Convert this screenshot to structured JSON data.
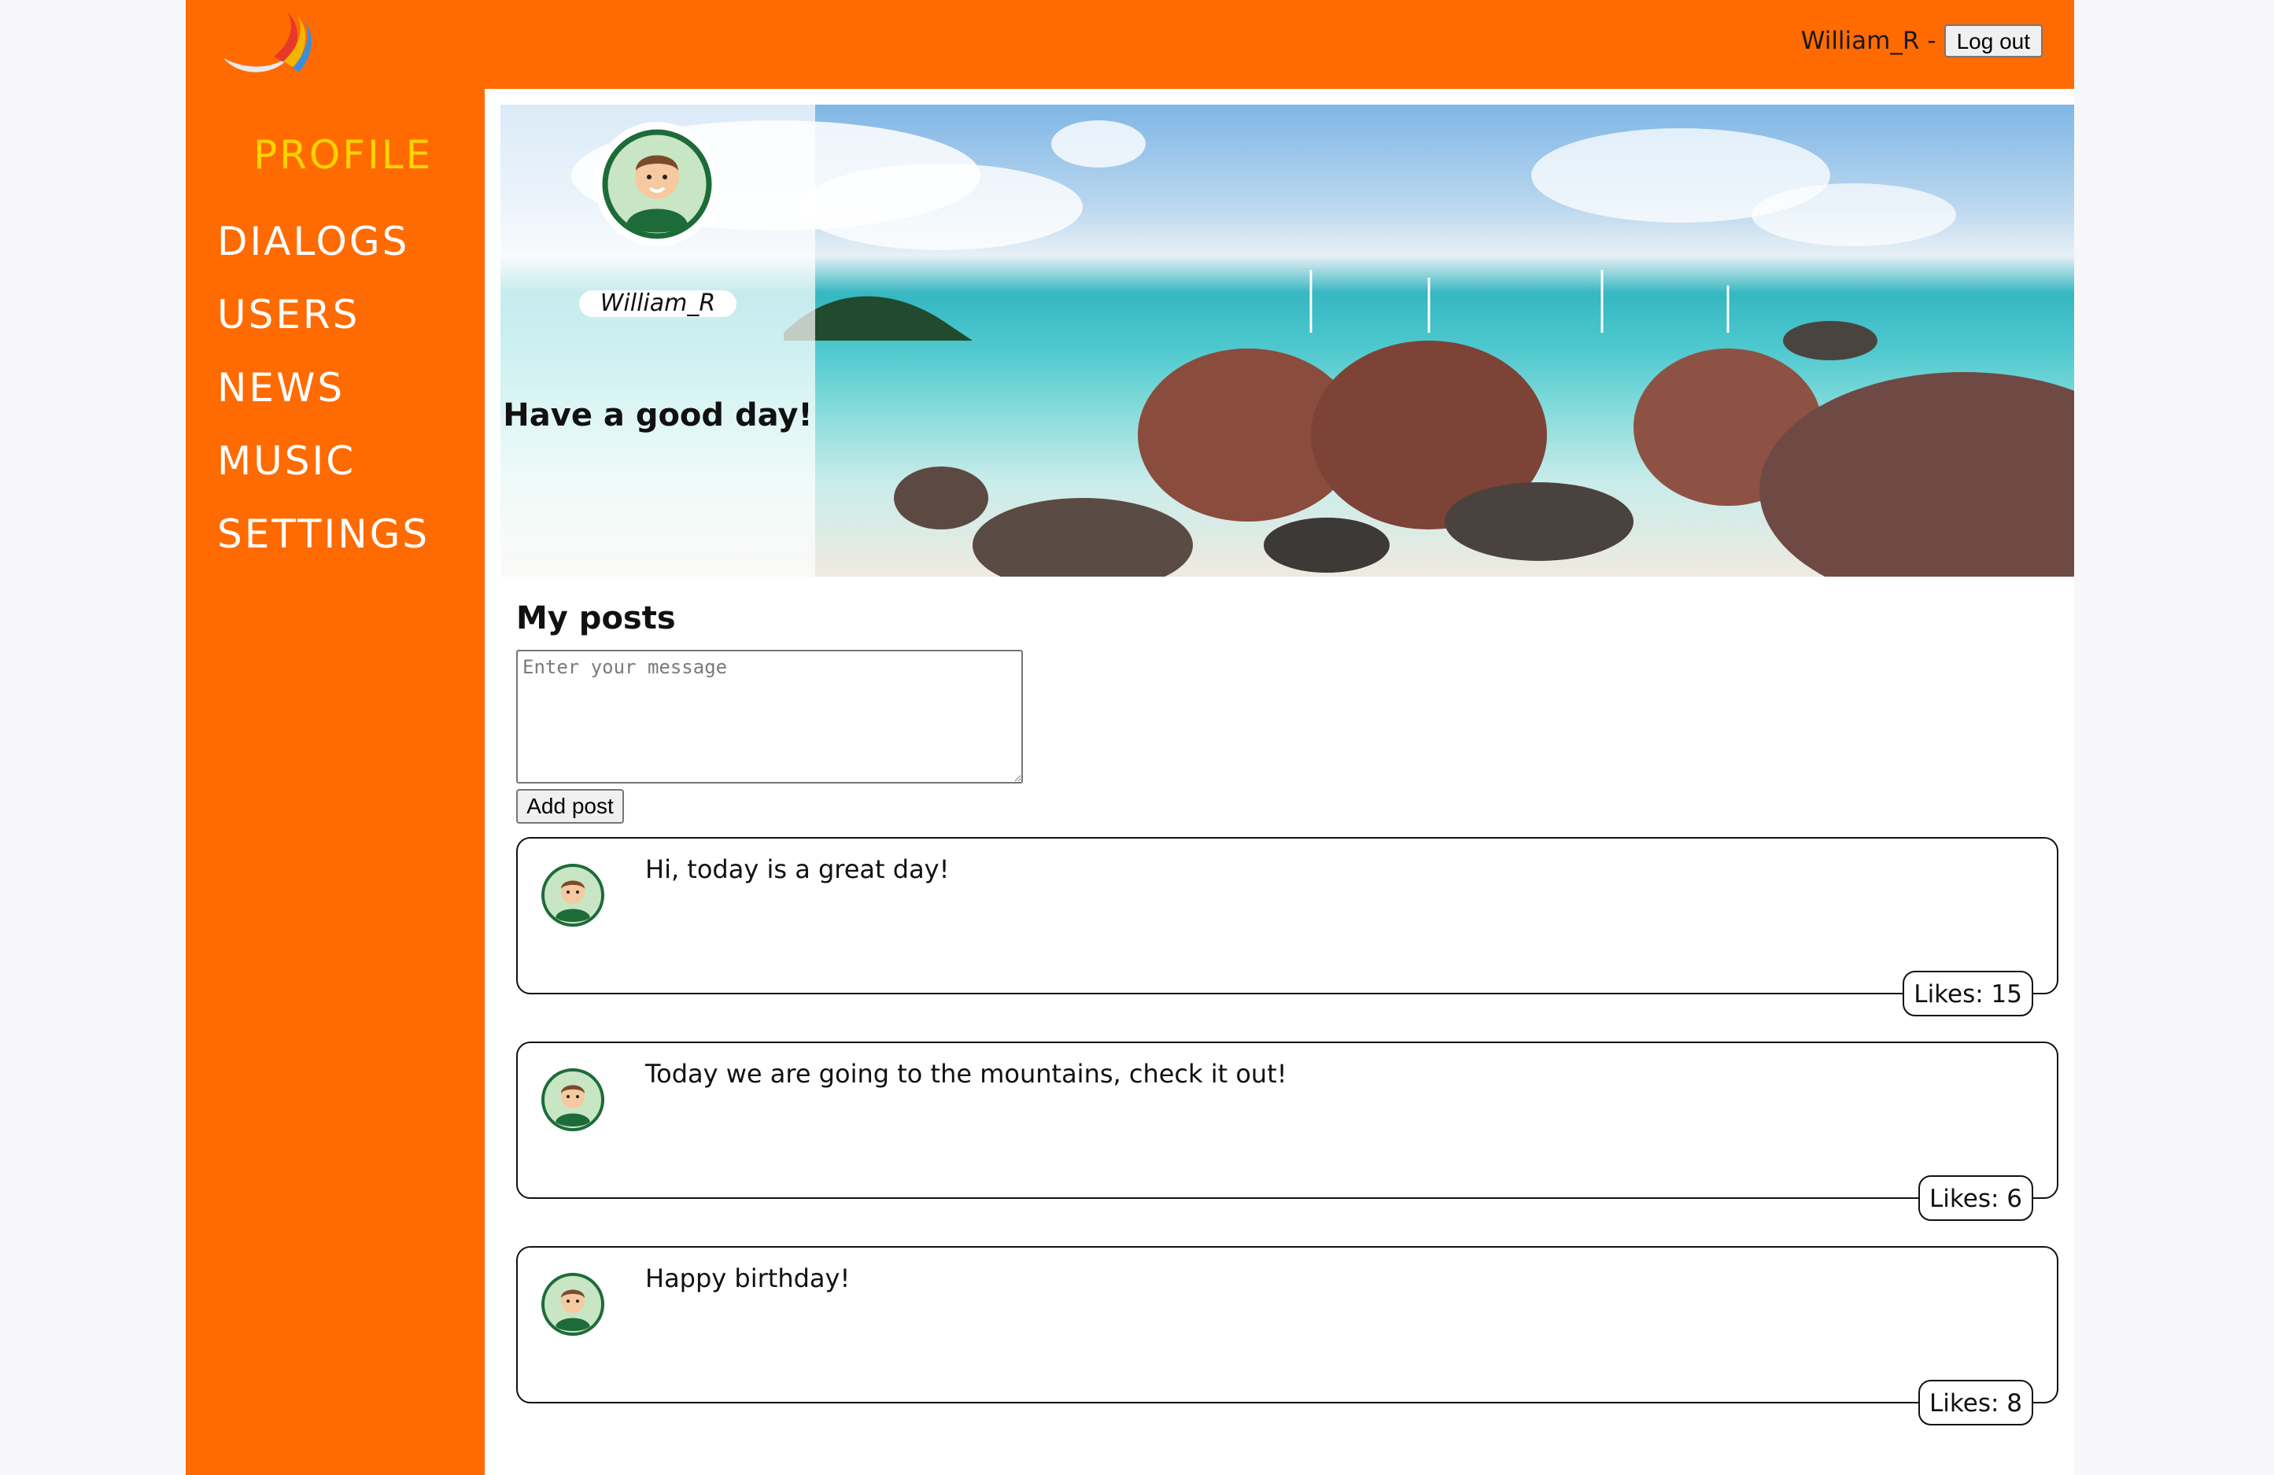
{
  "header": {
    "username": "William_R",
    "separator": "-",
    "logout_label": "Log out"
  },
  "sidebar": {
    "items": [
      {
        "label": "PROFILE",
        "active": true
      },
      {
        "label": "DIALOGS"
      },
      {
        "label": "USERS"
      },
      {
        "label": "NEWS"
      },
      {
        "label": "MUSIC"
      },
      {
        "label": "SETTINGS"
      }
    ]
  },
  "profile": {
    "name": "William_R",
    "status": "Have a good day!"
  },
  "posts_section": {
    "title": "My posts",
    "input_placeholder": "Enter your message",
    "add_label": "Add post"
  },
  "posts": [
    {
      "text": "Hi, today is a great day!",
      "likes": "Likes: 15"
    },
    {
      "text": "Today we are going to the mountains, check it out!",
      "likes": "Likes: 6"
    },
    {
      "text": "Happy birthday!",
      "likes": "Likes: 8"
    }
  ],
  "colors": {
    "brand": "#ff6b00",
    "active_nav": "#ffd400"
  }
}
